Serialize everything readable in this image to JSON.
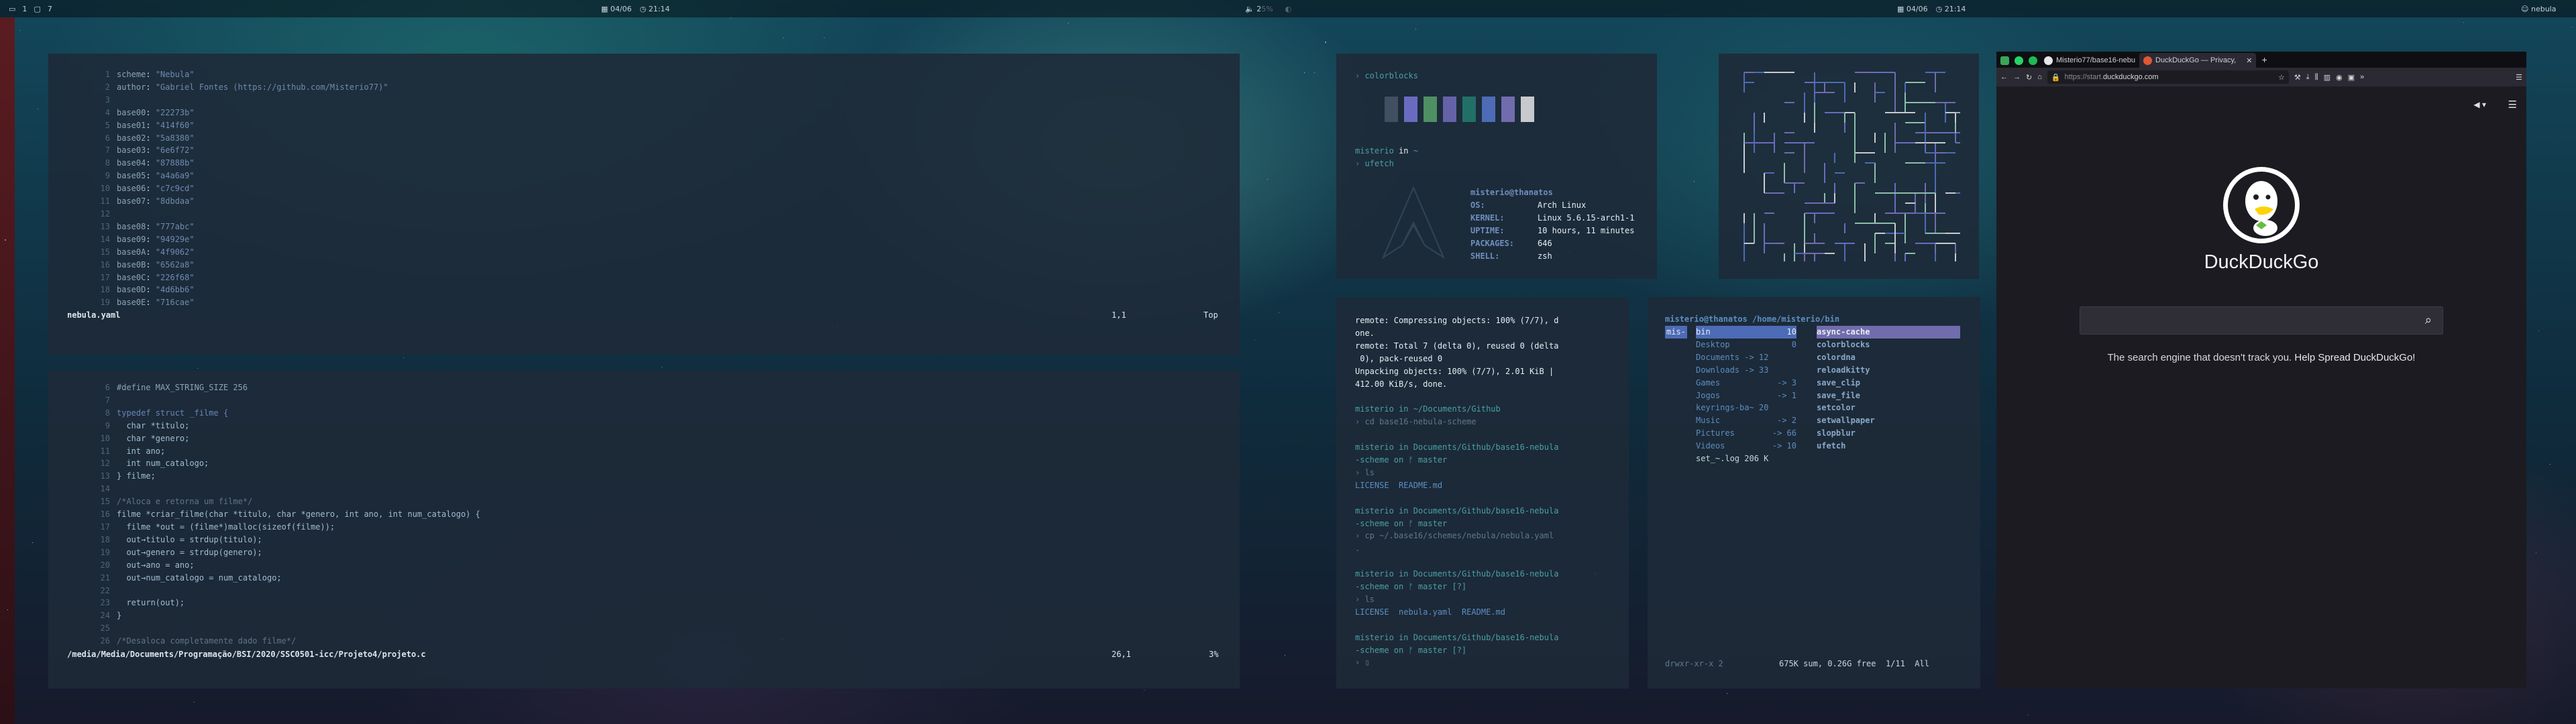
{
  "topbar": {
    "workspaces": "1",
    "window_count": "7",
    "left_date": "04/06",
    "left_time": "21:14",
    "volume": "25%",
    "right_date": "04/06",
    "right_time": "21:14",
    "hostname": "nebula"
  },
  "editor_top": {
    "lines": [
      {
        "n": "1",
        "key": "scheme",
        "val": "\"Nebula\""
      },
      {
        "n": "2",
        "key": "author",
        "val": "\"Gabriel Fontes (https://github.com/Misterio77)\""
      },
      {
        "n": "3",
        "key": "",
        "val": ""
      },
      {
        "n": "4",
        "key": "base00",
        "val": "\"22273b\""
      },
      {
        "n": "5",
        "key": "base01",
        "val": "\"414f60\""
      },
      {
        "n": "6",
        "key": "base02",
        "val": "\"5a8380\""
      },
      {
        "n": "7",
        "key": "base03",
        "val": "\"6e6f72\""
      },
      {
        "n": "8",
        "key": "base04",
        "val": "\"87888b\""
      },
      {
        "n": "9",
        "key": "base05",
        "val": "\"a4a6a9\""
      },
      {
        "n": "10",
        "key": "base06",
        "val": "\"c7c9cd\""
      },
      {
        "n": "11",
        "key": "base07",
        "val": "\"8dbdaa\""
      },
      {
        "n": "12",
        "key": "",
        "val": ""
      },
      {
        "n": "13",
        "key": "base08",
        "val": "\"777abc\""
      },
      {
        "n": "14",
        "key": "base09",
        "val": "\"94929e\""
      },
      {
        "n": "15",
        "key": "base0A",
        "val": "\"4f9062\""
      },
      {
        "n": "16",
        "key": "base0B",
        "val": "\"6562a8\""
      },
      {
        "n": "17",
        "key": "base0C",
        "val": "\"226f68\""
      },
      {
        "n": "18",
        "key": "base0D",
        "val": "\"4d6bb6\""
      },
      {
        "n": "19",
        "key": "base0E",
        "val": "\"716cae\""
      }
    ],
    "filename": "nebula.yaml",
    "position": "1,1",
    "scroll": "Top"
  },
  "editor_bottom": {
    "lines": [
      {
        "n": "6",
        "text": "#define MAX_STRING_SIZE 256"
      },
      {
        "n": "7",
        "text": ""
      },
      {
        "n": "8",
        "text": "typedef struct _filme {"
      },
      {
        "n": "9",
        "text": "  char *titulo;"
      },
      {
        "n": "10",
        "text": "  char *genero;"
      },
      {
        "n": "11",
        "text": "  int ano;"
      },
      {
        "n": "12",
        "text": "  int num_catalogo;"
      },
      {
        "n": "13",
        "text": "} filme;"
      },
      {
        "n": "14",
        "text": ""
      },
      {
        "n": "15",
        "text": "/*Aloca e retorna um filme*/"
      },
      {
        "n": "16",
        "text": "filme *criar_filme(char *titulo, char *genero, int ano, int num_catalogo) {"
      },
      {
        "n": "17",
        "text": "  filme *out = (filme*)malloc(sizeof(filme));"
      },
      {
        "n": "18",
        "text": "  out→titulo = strdup(titulo);"
      },
      {
        "n": "19",
        "text": "  out→genero = strdup(genero);"
      },
      {
        "n": "20",
        "text": "  out→ano = ano;"
      },
      {
        "n": "21",
        "text": "  out→num_catalogo = num_catalogo;"
      },
      {
        "n": "22",
        "text": ""
      },
      {
        "n": "23",
        "text": "  return(out);"
      },
      {
        "n": "24",
        "text": "}"
      },
      {
        "n": "25",
        "text": ""
      },
      {
        "n": "26",
        "text": "/*Desaloca completamente dado filme*/"
      }
    ],
    "filename": "/media/Media/Documents/Programação/BSI/2020/SSC0501-icc/Projeto4/projeto.c",
    "position": "26,1",
    "scroll": "3%"
  },
  "colorblocks": {
    "cmd": "colorblocks",
    "colors": [
      "#414f60",
      "#6a6bc0",
      "#4f9062",
      "#6562a8",
      "#226f68",
      "#4d6bb6",
      "#716cae",
      "#c7c9cd"
    ],
    "prompt_user": "misterio",
    "prompt_in": "in",
    "prompt_dir": "~",
    "ufetch": "ufetch",
    "userhost": "misterio@thanatos",
    "info": [
      {
        "k": "OS:",
        "v": "Arch Linux"
      },
      {
        "k": "KERNEL:",
        "v": "Linux 5.6.15-arch1-1"
      },
      {
        "k": "UPTIME:",
        "v": "10 hours, 11 minutes"
      },
      {
        "k": "PACKAGES:",
        "v": "646"
      },
      {
        "k": "SHELL:",
        "v": "zsh"
      }
    ]
  },
  "git_terminal": {
    "lines": [
      {
        "c": "white",
        "t": "remote: Compressing objects: 100% (7/7), d"
      },
      {
        "c": "white",
        "t": "one."
      },
      {
        "c": "white",
        "t": "remote: Total 7 (delta 0), reused 0 (delta"
      },
      {
        "c": "white",
        "t": " 0), pack-reused 0"
      },
      {
        "c": "white",
        "t": "Unpacking objects: 100% (7/7), 2.01 KiB |"
      },
      {
        "c": "white",
        "t": "412.00 KiB/s, done."
      },
      {
        "c": "",
        "t": ""
      },
      {
        "c": "prompt",
        "t": "misterio in ~/Documents/Github"
      },
      {
        "c": "cmd",
        "t": "› cd base16-nebula-scheme"
      },
      {
        "c": "",
        "t": ""
      },
      {
        "c": "prompt",
        "t": "misterio in Documents/Github/base16-nebula"
      },
      {
        "c": "prompt",
        "t": "-scheme on ᚠ master"
      },
      {
        "c": "cmd",
        "t": "› ls"
      },
      {
        "c": "blue",
        "t": "LICENSE  README.md"
      },
      {
        "c": "",
        "t": ""
      },
      {
        "c": "prompt",
        "t": "misterio in Documents/Github/base16-nebula"
      },
      {
        "c": "prompt",
        "t": "-scheme on ᚠ master"
      },
      {
        "c": "cmd",
        "t": "› cp ~/.base16/schemes/nebula/nebula.yaml"
      },
      {
        "c": "cmd",
        "t": "."
      },
      {
        "c": "",
        "t": ""
      },
      {
        "c": "prompt",
        "t": "misterio in Documents/Github/base16-nebula"
      },
      {
        "c": "prompt",
        "t": "-scheme on ᚠ master [?]"
      },
      {
        "c": "cmd",
        "t": "› ls"
      },
      {
        "c": "blue",
        "t": "LICENSE  nebula.yaml  README.md"
      },
      {
        "c": "",
        "t": ""
      },
      {
        "c": "prompt",
        "t": "misterio in Documents/Github/base16-nebula"
      },
      {
        "c": "prompt",
        "t": "-scheme on ᚠ master [?]"
      },
      {
        "c": "cmd",
        "t": "› ▯"
      }
    ]
  },
  "file_manager": {
    "header": "misterio@thanatos /home/misterio/bin",
    "mode": "mis-",
    "left": [
      {
        "name": "bin",
        "count": "10"
      },
      {
        "name": "Desktop",
        "count": "0"
      },
      {
        "name": "Documents -> 12",
        "count": ""
      },
      {
        "name": "Downloads -> 33",
        "count": ""
      },
      {
        "name": "Games",
        "count": "-> 3"
      },
      {
        "name": "Jogos",
        "count": "-> 1"
      },
      {
        "name": "keyrings-ba~ 20",
        "count": ""
      },
      {
        "name": "Music",
        "count": "-> 2"
      },
      {
        "name": "Pictures",
        "count": "-> 66"
      },
      {
        "name": "Videos",
        "count": "-> 10"
      },
      {
        "name": "set_~.log 206 K",
        "count": ""
      }
    ],
    "right": [
      "async-cache",
      "colorblocks",
      "colordna",
      "reloadkitty",
      "save_clip",
      "save_file",
      "setcolor",
      "setwallpaper",
      "slopblur",
      "ufetch"
    ],
    "footer_left": "drwxr-xr-x 2",
    "footer_right": "675K sum, 0.26G free  1/11  All"
  },
  "browser": {
    "tabs": [
      {
        "label": "Misterio77/base16-nebu"
      },
      {
        "label": "DuckDuckGo — Privacy,"
      }
    ],
    "url_prefix": "https://start.",
    "url_domain": "duckduckgo.com",
    "logo_text": "DuckDuckGo",
    "tagline": "The search engine that doesn't track you.",
    "tagline_link": "Help Spread DuckDuckGo!"
  }
}
